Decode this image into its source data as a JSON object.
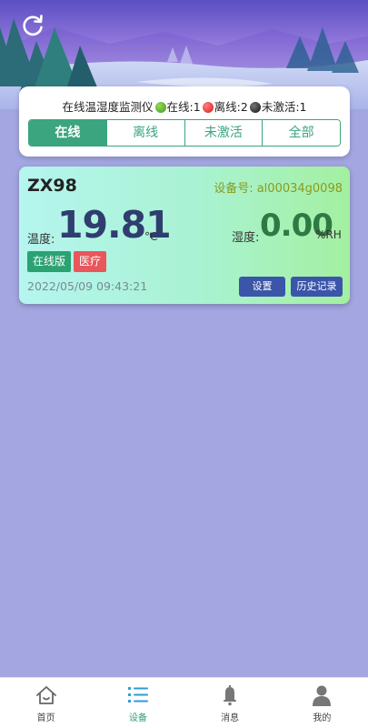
{
  "header": {
    "refresh_icon": "refresh-icon"
  },
  "summary": {
    "title": "在线温湿度监测仪",
    "online_label": "在线:1",
    "offline_label": "离线:2",
    "inactive_label": "未激活:1",
    "colors": {
      "online": "#3c9a18",
      "offline": "#d91818",
      "inactive": "#111111",
      "accent": "#3aa57e"
    }
  },
  "tabs": [
    {
      "label": "在线",
      "active": true
    },
    {
      "label": "离线",
      "active": false
    },
    {
      "label": "未激活",
      "active": false
    },
    {
      "label": "全部",
      "active": false
    }
  ],
  "device": {
    "name": "ZX98",
    "id_label": "设备号: al00034g0098",
    "temperature_label": "温度:",
    "temperature_value": "19.81",
    "temperature_unit": "°C",
    "humidity_label": "湿度:",
    "humidity_value": "0.00",
    "humidity_unit": "%RH",
    "badge_online": "在线版",
    "badge_medical": "医疗",
    "timestamp": "2022/05/09 09:43:21",
    "settings_button": "设置",
    "history_button": "历史记录"
  },
  "bottom_nav": [
    {
      "label": "首页",
      "icon": "home-icon",
      "active": false
    },
    {
      "label": "设备",
      "icon": "list-icon",
      "active": true
    },
    {
      "label": "消息",
      "icon": "bell-icon",
      "active": false
    },
    {
      "label": "我的",
      "icon": "user-icon",
      "active": false
    }
  ]
}
